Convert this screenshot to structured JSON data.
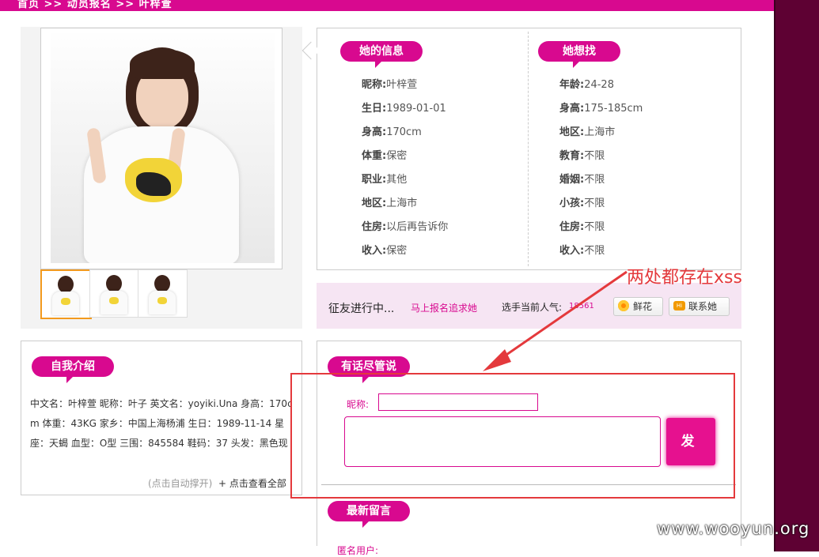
{
  "breadcrumb": {
    "text": "首页 >> 动员报名 >> 叶梓萱"
  },
  "her_info": {
    "title": "她的信息",
    "rows": [
      {
        "label": "昵称:",
        "value": "叶梓萱"
      },
      {
        "label": "生日:",
        "value": "1989-01-01"
      },
      {
        "label": "身高:",
        "value": "170cm"
      },
      {
        "label": "体重:",
        "value": "保密"
      },
      {
        "label": "职业:",
        "value": "其他"
      },
      {
        "label": "地区:",
        "value": "上海市"
      },
      {
        "label": "住房:",
        "value": "以后再告诉你"
      },
      {
        "label": "收入:",
        "value": "保密"
      }
    ]
  },
  "she_wants": {
    "title": "她想找",
    "rows": [
      {
        "label": "年龄:",
        "value": "24-28"
      },
      {
        "label": "身高:",
        "value": "175-185cm"
      },
      {
        "label": "地区:",
        "value": "上海市"
      },
      {
        "label": "教育:",
        "value": "不限"
      },
      {
        "label": "婚姻:",
        "value": "不限"
      },
      {
        "label": "小孩:",
        "value": "不限"
      },
      {
        "label": "住房:",
        "value": "不限"
      },
      {
        "label": "收入:",
        "value": "不限"
      }
    ]
  },
  "annotation": {
    "text": "两处都存在xss",
    "color": "#e4393c"
  },
  "pursuit": {
    "status": "征友进行中...",
    "signup_link": "马上报名追求她",
    "popularity_label": "选手当前人气:",
    "popularity_value": "18561",
    "flower_button": "鲜花",
    "contact_button": "联系她"
  },
  "intro": {
    "title": "自我介绍",
    "text": "中文名：叶梓萱 昵称：叶子 英文名：yoyiki.Una 身高：170cm 体重：43KG 家乡：中国上海杨浦 生日：1989-11-14 星座：天蝎 血型：O型 三围：845584 鞋码：37 头发：黑色现在(棕黄) 职业：在校学生 交友格言：寻找自己的工蕨新一",
    "expand_hint": "(点击自动撑开)",
    "view_all": "+ 点击查看全部"
  },
  "message": {
    "title": "有话尽管说",
    "nickname_label": "昵称:",
    "publish_button": "发 布",
    "latest_title": "最新留言",
    "anon_label": "匿名用户:"
  },
  "watermark": "www.wooyun.org",
  "colors": {
    "brand": "#d8098f",
    "sidebar": "#5e0133",
    "annotation": "#e4393c"
  }
}
